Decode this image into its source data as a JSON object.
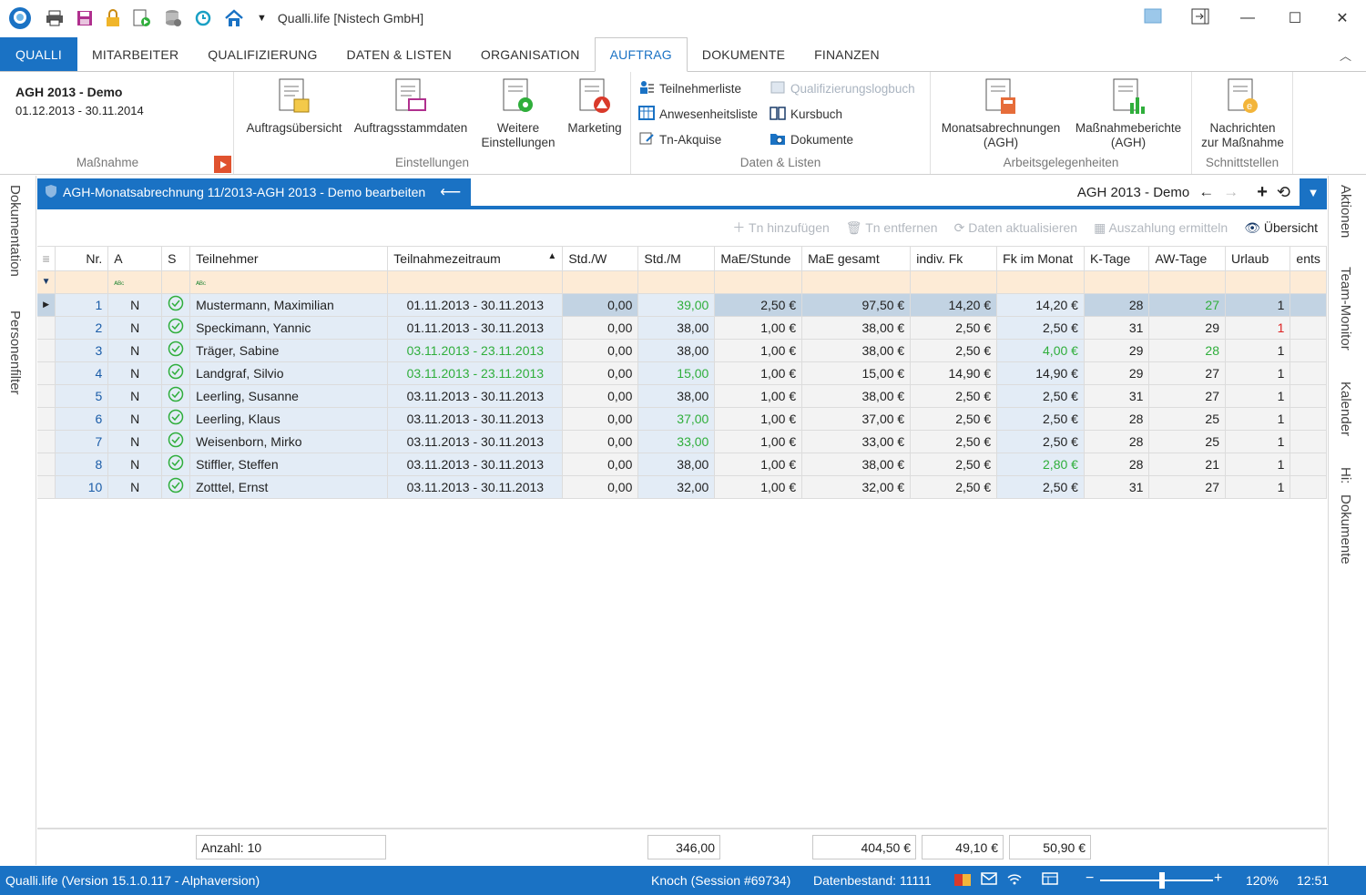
{
  "app": {
    "title": "Qualli.life [Nistech GmbH]"
  },
  "tabs": [
    "QUALLI",
    "MITARBEITER",
    "QUALIFIZIERUNG",
    "DATEN & LISTEN",
    "ORGANISATION",
    "AUFTRAG",
    "DOKUMENTE",
    "FINANZEN"
  ],
  "ribbon": {
    "massnahme": {
      "name": "AGH 2013 - Demo",
      "dates": "01.12.2013 - 30.11.2014",
      "label": "Maßnahme"
    },
    "einstellungen": {
      "label": "Einstellungen",
      "auftragsuebersicht": "Auftragsübersicht",
      "auftragsstammdaten": "Auftragsstammdaten",
      "weitere1": "Weitere",
      "weitere2": "Einstellungen",
      "marketing": "Marketing"
    },
    "daten": {
      "label": "Daten & Listen",
      "teilnehmerliste": "Teilnehmerliste",
      "anwesenheitsliste": "Anwesenheitsliste",
      "tnakquise": "Tn-Akquise",
      "qlogbuch": "Qualifizierungslogbuch",
      "kursbuch": "Kursbuch",
      "dokumente": "Dokumente"
    },
    "arbeit": {
      "label": "Arbeitsgelegenheiten",
      "monats1": "Monatsabrechnungen",
      "monats2": "(AGH)",
      "mass1": "Maßnahmeberichte",
      "mass2": "(AGH)"
    },
    "schnitt": {
      "label": "Schnittstellen",
      "nach1": "Nachrichten",
      "nach2": "zur Maßnahme"
    }
  },
  "left_tabs": [
    "Dokumentation",
    "Personenfilter"
  ],
  "right_tabs": [
    "Aktionen",
    "Team-Monitor",
    "Kalender",
    "Hi:",
    "Dokumente"
  ],
  "doc": {
    "tab_title": "AGH-Monatsabrechnung 11/2013-AGH 2013 - Demo bearbeiten",
    "context": "AGH 2013 - Demo"
  },
  "toolbar": {
    "add": "Tn hinzufügen",
    "remove": "Tn entfernen",
    "refresh": "Daten aktualisieren",
    "payout": "Auszahlung ermitteln",
    "overview": "Übersicht"
  },
  "grid": {
    "columns": [
      "Nr.",
      "A",
      "S",
      "Teilnehmer",
      "Teilnahmezeitraum",
      "Std./W",
      "Std./M",
      "MaE/Stunde",
      "MaE gesamt",
      "indiv. Fk",
      "Fk im Monat",
      "K-Tage",
      "AW-Tage",
      "Urlaub",
      "ents"
    ],
    "rows": [
      [
        "1",
        "N",
        "✓",
        "Mustermann, Maximilian",
        "01.11.2013 - 30.11.2013",
        "0,00",
        "39,00",
        "2,50 €",
        "97,50 €",
        "14,20 €",
        "14,20 €",
        "28",
        "27",
        "1"
      ],
      [
        "2",
        "N",
        "✓",
        "Speckimann, Yannic",
        "01.11.2013 - 30.11.2013",
        "0,00",
        "38,00",
        "1,00 €",
        "38,00 €",
        "2,50 €",
        "2,50 €",
        "31",
        "29",
        "1"
      ],
      [
        "3",
        "N",
        "✓",
        "Träger, Sabine",
        "03.11.2013 - 23.11.2013",
        "0,00",
        "38,00",
        "1,00 €",
        "38,00 €",
        "2,50 €",
        "4,00 €",
        "29",
        "28",
        "1"
      ],
      [
        "4",
        "N",
        "✓",
        "Landgraf, Silvio",
        "03.11.2013 - 23.11.2013",
        "0,00",
        "15,00",
        "1,00 €",
        "15,00 €",
        "14,90 €",
        "14,90 €",
        "29",
        "27",
        "1"
      ],
      [
        "5",
        "N",
        "✓",
        "Leerling, Susanne",
        "03.11.2013 - 30.11.2013",
        "0,00",
        "38,00",
        "1,00 €",
        "38,00 €",
        "2,50 €",
        "2,50 €",
        "31",
        "27",
        "1"
      ],
      [
        "6",
        "N",
        "✓",
        "Leerling, Klaus",
        "03.11.2013 - 30.11.2013",
        "0,00",
        "37,00",
        "1,00 €",
        "37,00 €",
        "2,50 €",
        "2,50 €",
        "28",
        "25",
        "1"
      ],
      [
        "7",
        "N",
        "✓",
        "Weisenborn, Mirko",
        "03.11.2013 - 30.11.2013",
        "0,00",
        "33,00",
        "1,00 €",
        "33,00 €",
        "2,50 €",
        "2,50 €",
        "28",
        "25",
        "1"
      ],
      [
        "8",
        "N",
        "✓",
        "Stiffler, Steffen",
        "03.11.2013 - 30.11.2013",
        "0,00",
        "38,00",
        "1,00 €",
        "38,00 €",
        "2,50 €",
        "2,80 €",
        "28",
        "21",
        "1"
      ],
      [
        "10",
        "N",
        "✓",
        "Zotttel, Ernst",
        "03.11.2013 - 30.11.2013",
        "0,00",
        "32,00",
        "1,00 €",
        "32,00 €",
        "2,50 €",
        "2,50 €",
        "31",
        "27",
        "1"
      ]
    ]
  },
  "footer": {
    "count": "Anzahl: 10",
    "std_m": "346,00",
    "mae_gesamt": "404,50 €",
    "indiv_fk": "49,10 €",
    "fk_monat": "50,90 €"
  },
  "status": {
    "version": "Qualli.life (Version 15.1.0.117 - Alphaversion)",
    "user": "Knoch (Session #69734)",
    "db": "Datenbestand: 11111",
    "zoom": "120%",
    "time": "12:51"
  },
  "colors": {
    "accent": "#1a72c4",
    "green": "#2fae3b",
    "red": "#dd2222",
    "filter_row": "#fdebd6",
    "selected_row": "#c2d3e3"
  }
}
